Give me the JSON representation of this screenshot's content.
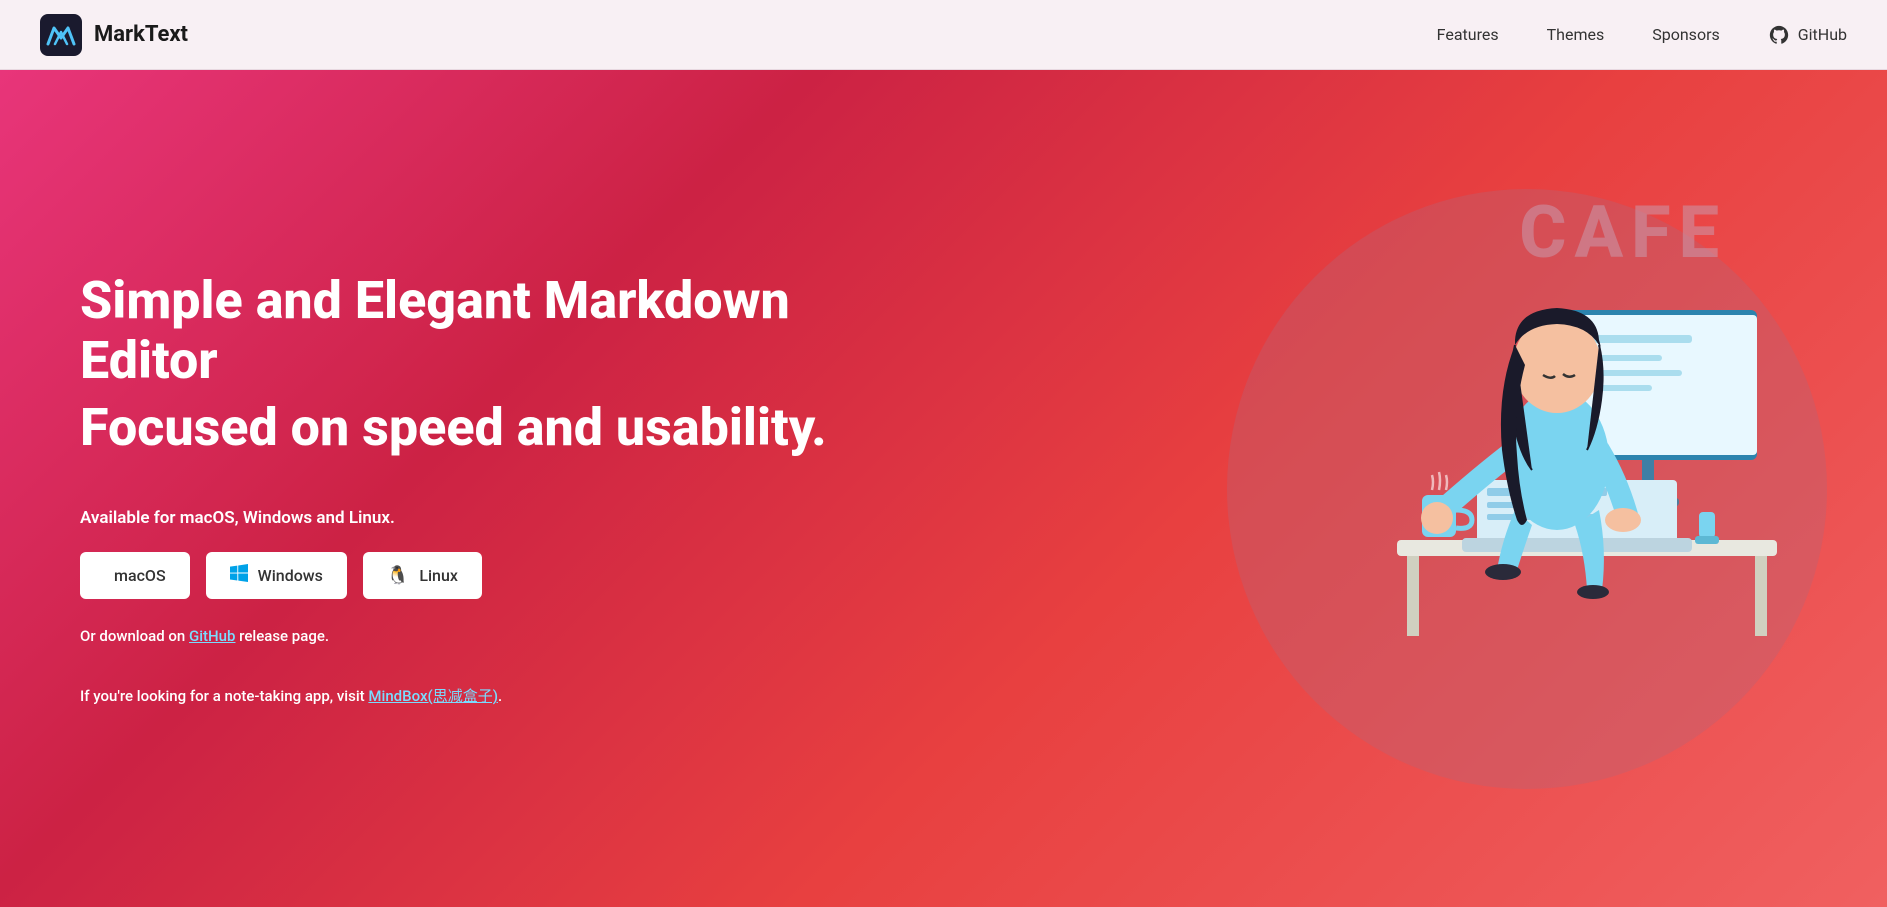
{
  "navbar": {
    "brand_name": "MarkText",
    "links": [
      {
        "label": "Features",
        "href": "#features"
      },
      {
        "label": "Themes",
        "href": "#themes"
      },
      {
        "label": "Sponsors",
        "href": "#sponsors"
      }
    ],
    "github_label": "GitHub",
    "github_href": "https://github.com/marktext/marktext"
  },
  "hero": {
    "title_line1": "Simple and Elegant Markdown Editor",
    "title_line2": "Focused on speed and usability.",
    "available_text": "Available for macOS, Windows and Linux.",
    "buttons": [
      {
        "label": "macOS",
        "icon": "apple"
      },
      {
        "label": "Windows",
        "icon": "windows"
      },
      {
        "label": "Linux",
        "icon": "linux"
      }
    ],
    "github_text_before": "Or download on ",
    "github_link_label": "GitHub",
    "github_text_after": " release page.",
    "note_before": "If you're looking for a note-taking app, visit ",
    "note_link_label": "MindBox(思减盒子)",
    "note_after": ".",
    "cafe_bg_text": "CAFE",
    "illustration_alt": "Woman working on laptop at cafe"
  }
}
